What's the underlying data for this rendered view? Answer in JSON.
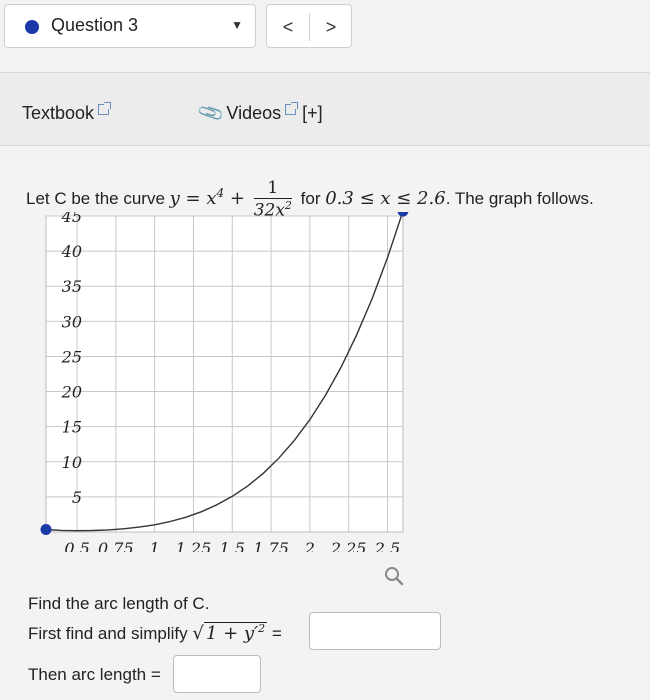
{
  "question": {
    "label": "Question 3"
  },
  "nav": {
    "prev": "<",
    "next": ">"
  },
  "resources": {
    "textbook": "Textbook",
    "videos": "Videos",
    "more": "[+]"
  },
  "problem": {
    "intro_prefix": "Let C be the curve ",
    "equation_lhs": "y = x",
    "exponent": "4",
    "plus": " +",
    "fraction_num": "1",
    "fraction_den": "32x",
    "fraction_den_exp": "2",
    "range_prefix": " for ",
    "range": "0.3 ≤ x ≤ 2.6",
    "range_suffix": ". The graph follows."
  },
  "chart_data": {
    "type": "line",
    "function": "y = x^4 + 1/(32x^2)",
    "x": [
      0.3,
      0.4,
      0.5,
      0.6,
      0.7,
      0.8,
      0.9,
      1.0,
      1.1,
      1.2,
      1.3,
      1.4,
      1.5,
      1.6,
      1.7,
      1.8,
      1.9,
      2.0,
      2.1,
      2.2,
      2.3,
      2.4,
      2.5,
      2.6
    ],
    "y": [
      0.355,
      0.221,
      0.188,
      0.217,
      0.304,
      0.458,
      0.695,
      1.031,
      1.49,
      2.095,
      2.875,
      3.858,
      5.077,
      6.566,
      8.363,
      10.507,
      13.041,
      16.008,
      19.455,
      23.432,
      27.99,
      33.183,
      39.068,
      45.702
    ],
    "endpoints": [
      [
        0.3,
        0.355
      ],
      [
        2.6,
        45.702
      ]
    ],
    "xticks": [
      "0.5",
      "0.75",
      "1",
      "1.25",
      "1.5",
      "1.75",
      "2",
      "2.25",
      "2.5"
    ],
    "yticks": [
      "5",
      "10",
      "15",
      "20",
      "25",
      "30",
      "35",
      "40",
      "45"
    ],
    "xlim": [
      0.3,
      2.6
    ],
    "ylim": [
      0,
      45
    ],
    "grid": true,
    "series_color": "#1b3aa8",
    "line_color": "#333333"
  },
  "magnify": {
    "icon": "magnify-icon"
  },
  "parts": {
    "find": "Find the arc length of C.",
    "simplify_prefix": "First find and simplify",
    "sqrt_expr": "1 + y′",
    "sqrt_exp": "2",
    "equals": " =",
    "arc_label": "Then arc length ="
  }
}
